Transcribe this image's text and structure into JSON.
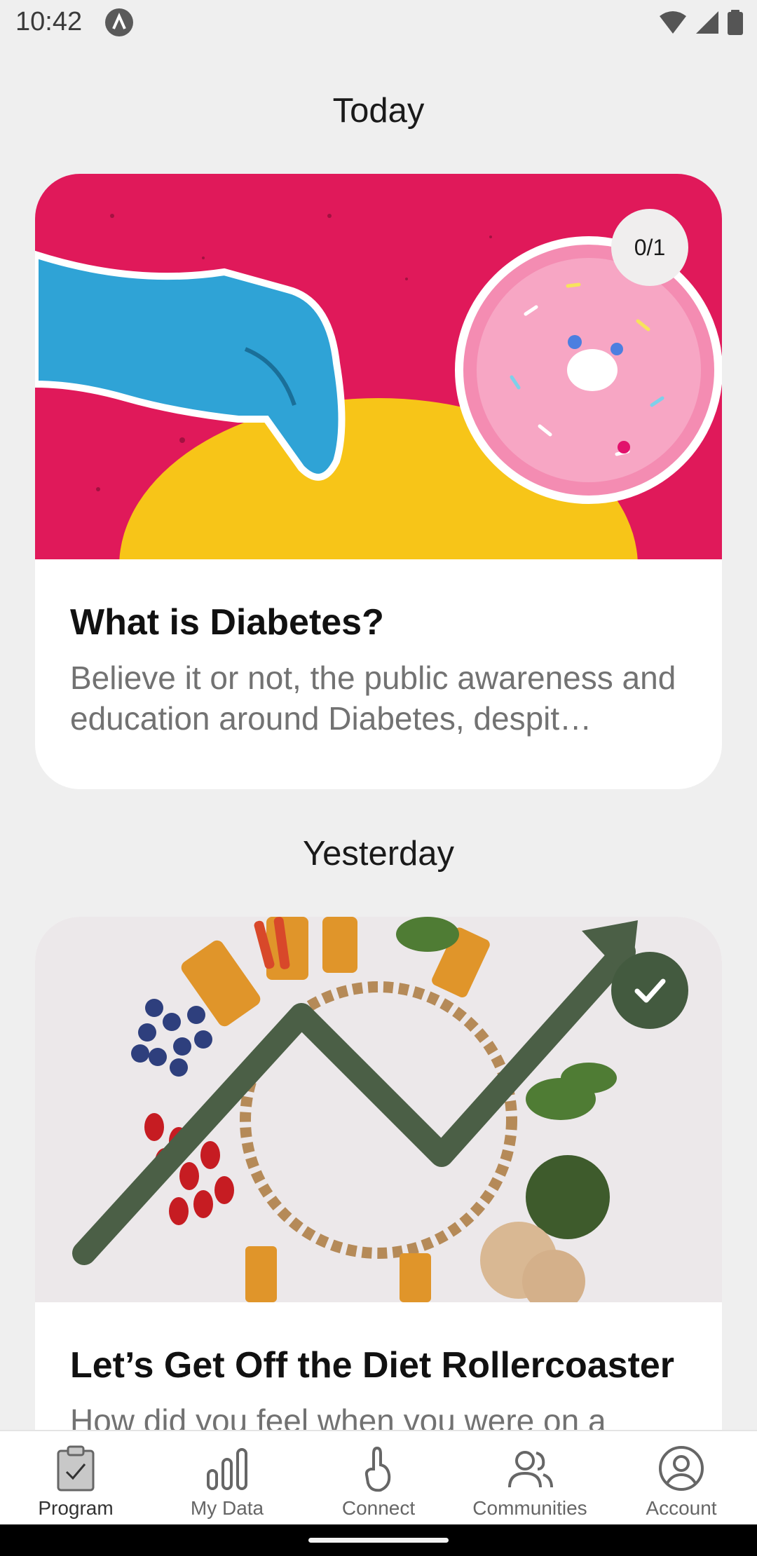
{
  "status_bar": {
    "time": "10:42"
  },
  "sections": [
    {
      "title": "Today",
      "card": {
        "title": "What is Diabetes?",
        "description": "Believe it or not, the public awareness and education around Diabetes, despit…",
        "progress": "0/1",
        "image_icon": "hand-donut-illustration"
      }
    },
    {
      "title": "Yesterday",
      "card": {
        "title": "Let’s Get Off the Diet Rollercoaster",
        "description": "How did you feel when you were on a",
        "completed": true,
        "image_icon": "food-circle-trend-illustration"
      }
    }
  ],
  "nav": {
    "items": [
      {
        "label": "Program",
        "icon": "clipboard-check-icon",
        "active": true
      },
      {
        "label": "My Data",
        "icon": "bar-chart-icon"
      },
      {
        "label": "Connect",
        "icon": "finger-touch-icon"
      },
      {
        "label": "Communities",
        "icon": "people-icon"
      },
      {
        "label": "Account",
        "icon": "account-circle-icon"
      }
    ]
  },
  "colors": {
    "card1_bg": "#e0195a",
    "card1_sun": "#f7c518",
    "check_badge": "#435a3f",
    "trend_arrow": "#4b5f46"
  }
}
